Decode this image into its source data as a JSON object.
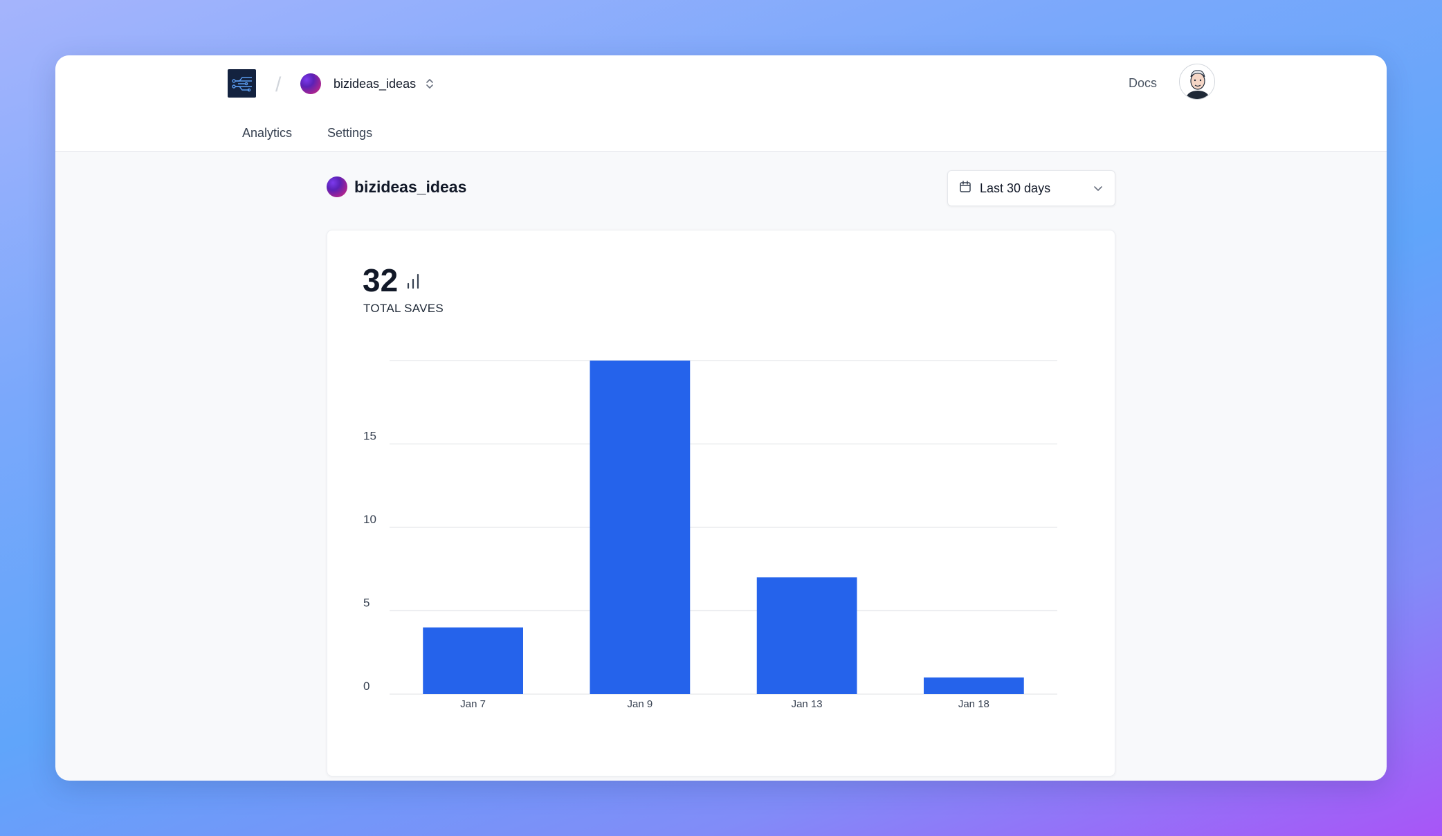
{
  "header": {
    "project_name": "bizideas_ideas",
    "docs_label": "Docs",
    "tabs": [
      {
        "label": "Analytics"
      },
      {
        "label": "Settings"
      }
    ]
  },
  "page": {
    "title": "bizideas_ideas",
    "date_range": "Last 30 days"
  },
  "metric": {
    "value": "32",
    "label": "TOTAL SAVES"
  },
  "icons": {
    "logo": "circuit-logo-icon",
    "switcher": "chevron-updown-icon",
    "calendar": "calendar-icon",
    "dropdown": "chevron-down-icon",
    "metric": "bar-chart-icon",
    "widget": "share-nodes-icon"
  },
  "colors": {
    "bar": "#2563eb",
    "grid": "#e5e7eb",
    "widget": "#4b5563"
  },
  "chart_data": {
    "type": "bar",
    "categories": [
      "Jan 7",
      "Jan 9",
      "Jan 13",
      "Jan 18"
    ],
    "values": [
      4,
      20,
      7,
      1
    ],
    "yticks": [
      0,
      5,
      10,
      15
    ],
    "ylim": [
      0,
      20
    ],
    "grid": true
  }
}
